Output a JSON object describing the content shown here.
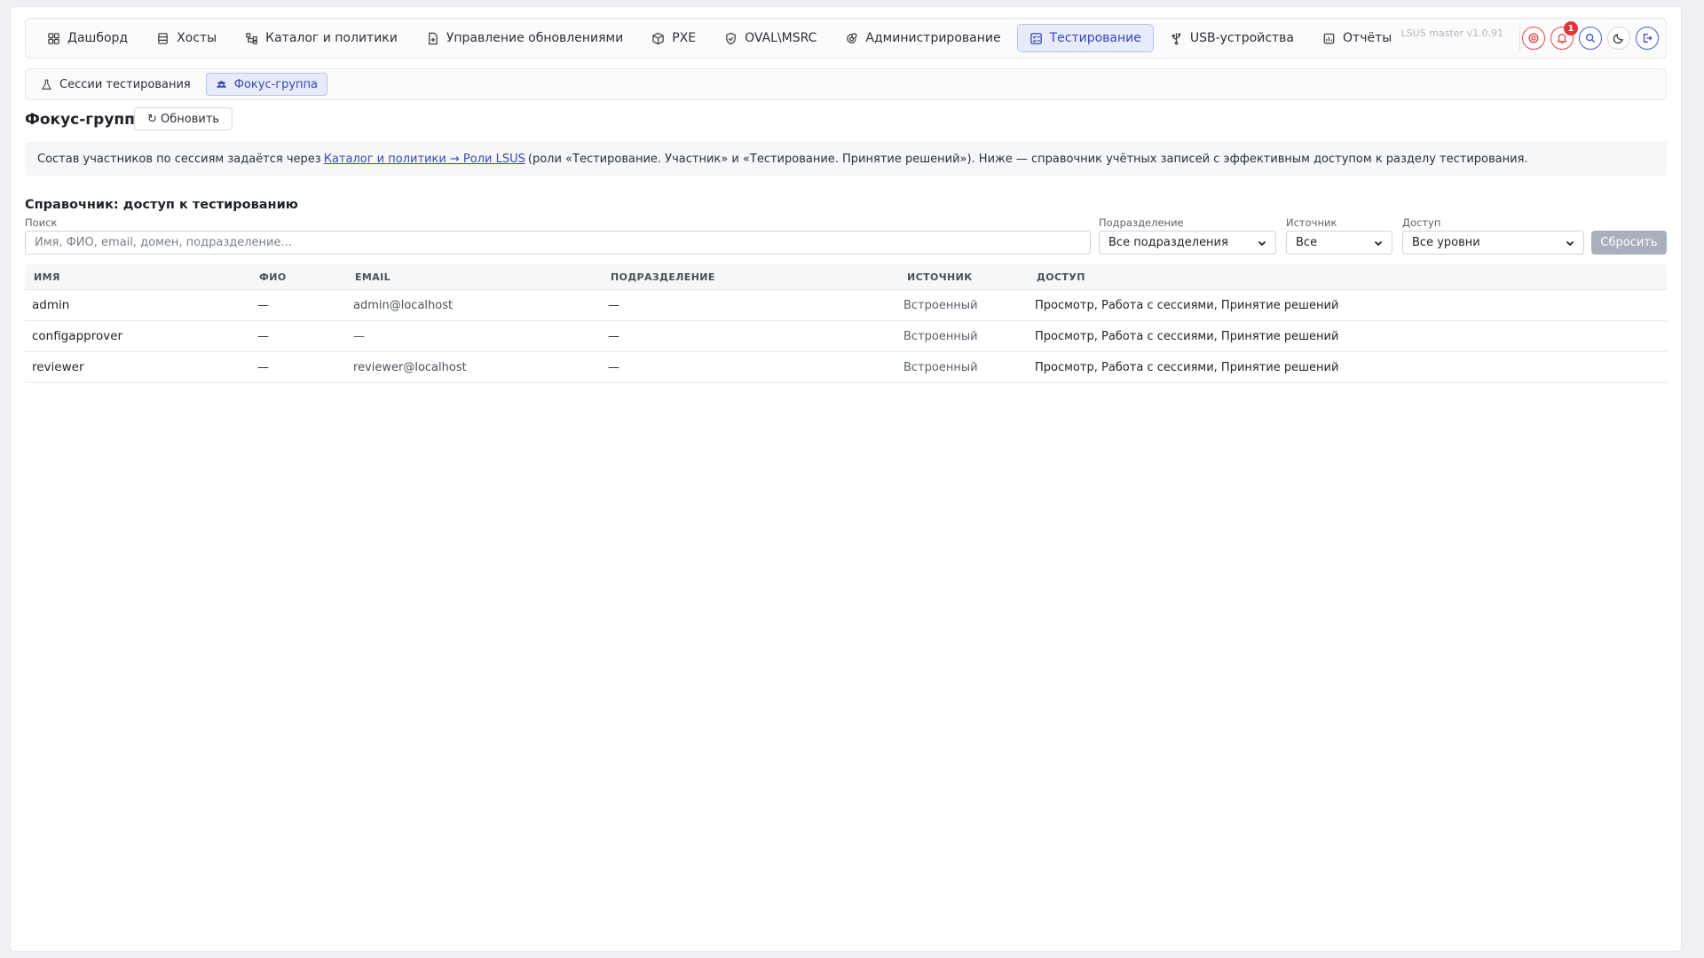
{
  "app": {
    "version": "LSUS master v1.0.91",
    "notifications_count": "1"
  },
  "nav": {
    "items": [
      {
        "label": "Дашборд",
        "icon": "dashboard-icon"
      },
      {
        "label": "Хосты",
        "icon": "server-icon"
      },
      {
        "label": "Каталог и политики",
        "icon": "hierarchy-icon"
      },
      {
        "label": "Управление обновлениями",
        "icon": "file-plus-icon"
      },
      {
        "label": "PXE",
        "icon": "cube-icon"
      },
      {
        "label": "OVAL\\MSRC",
        "icon": "shield-check-icon"
      },
      {
        "label": "Администрирование",
        "icon": "gear-shield-icon"
      },
      {
        "label": "Тестирование",
        "icon": "checklist-icon",
        "active": true
      },
      {
        "label": "USB-устройства",
        "icon": "usb-icon"
      },
      {
        "label": "Отчёты",
        "icon": "report-icon"
      }
    ]
  },
  "subnav": {
    "items": [
      {
        "label": "Сессии тестирования",
        "icon": "flask-icon"
      },
      {
        "label": "Фокус-группа",
        "icon": "users-icon",
        "active": true
      }
    ]
  },
  "page": {
    "title": "Фокус-группа",
    "refresh_label": "↻ Обновить"
  },
  "info": {
    "prefix": "Состав участников по сессиям задаётся через",
    "link": "Каталог и политики → Роли LSUS",
    "suffix": "(роли «Тестирование. Участник» и «Тестирование. Принятие решений»). Ниже — справочник учётных записей с эффективным доступом к разделу тестирования."
  },
  "directory": {
    "title": "Справочник: доступ к тестированию",
    "search_label": "Поиск",
    "search_placeholder": "Имя, ФИО, email, домен, подразделение...",
    "dept_label": "Подразделение",
    "dept_value": "Все подразделения",
    "source_label": "Источник",
    "source_value": "Все",
    "access_label": "Доступ",
    "access_value": "Все уровни",
    "reset_label": "Сбросить"
  },
  "table": {
    "headers": {
      "name": "ИМЯ",
      "fio": "ФИО",
      "email": "EMAIL",
      "dept": "ПОДРАЗДЕЛЕНИЕ",
      "source": "ИСТОЧНИК",
      "access": "ДОСТУП"
    },
    "rows": [
      {
        "name": "admin",
        "fio": "—",
        "email": "admin@localhost",
        "dept": "—",
        "source": "Встроенный",
        "access": "Просмотр, Работа с сессиями, Принятие решений"
      },
      {
        "name": "configapprover",
        "fio": "—",
        "email": "—",
        "dept": "—",
        "source": "Встроенный",
        "access": "Просмотр, Работа с сессиями, Принятие решений"
      },
      {
        "name": "reviewer",
        "fio": "—",
        "email": "reviewer@localhost",
        "dept": "—",
        "source": "Встроенный",
        "access": "Просмотр, Работа с сессиями, Принятие решений"
      }
    ]
  },
  "colors": {
    "accent": "#3a46b8",
    "active_bg": "#e8ebf9",
    "danger": "#e0353d"
  }
}
